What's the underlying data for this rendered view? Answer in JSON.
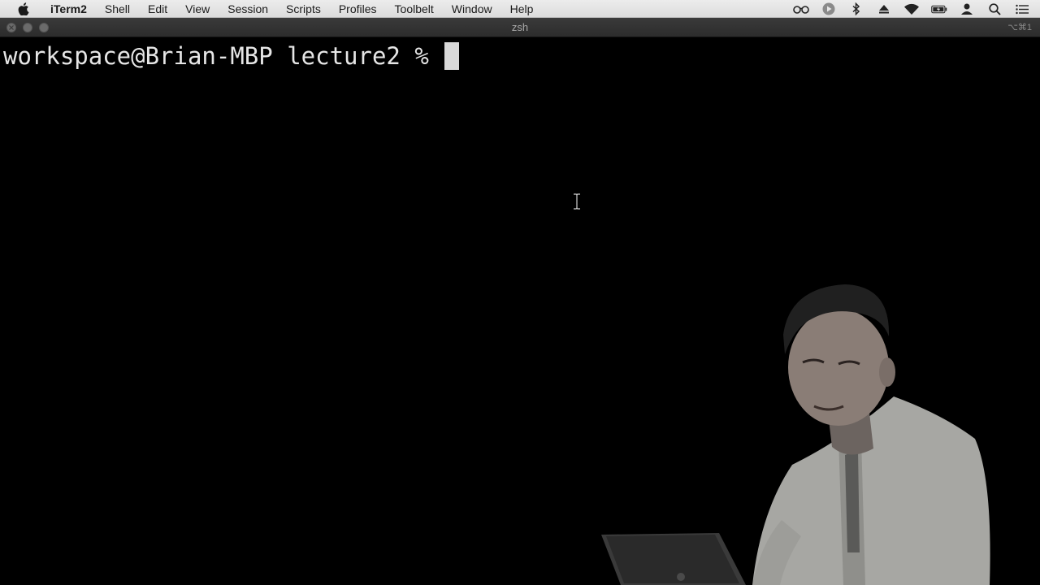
{
  "menubar": {
    "apple_icon": "apple-icon",
    "items": [
      {
        "label": "iTerm2",
        "app": true
      },
      {
        "label": "Shell"
      },
      {
        "label": "Edit"
      },
      {
        "label": "View"
      },
      {
        "label": "Session"
      },
      {
        "label": "Scripts"
      },
      {
        "label": "Profiles"
      },
      {
        "label": "Toolbelt"
      },
      {
        "label": "Window"
      },
      {
        "label": "Help"
      }
    ],
    "status_icons": [
      "glasses-icon",
      "record-icon",
      "bluetooth-icon",
      "eject-icon",
      "wifi-icon",
      "battery-icon",
      "user-icon",
      "search-icon",
      "list-icon"
    ]
  },
  "window": {
    "title": "zsh",
    "shortcut": "⌥⌘1"
  },
  "terminal": {
    "prompt": "workspace@Brian-MBP lecture2 % "
  },
  "colors": {
    "terminal_bg": "#000000",
    "terminal_fg": "#e6e6e6",
    "menubar_bg": "#e5e5e5",
    "titlebar_bg": "#333333"
  }
}
